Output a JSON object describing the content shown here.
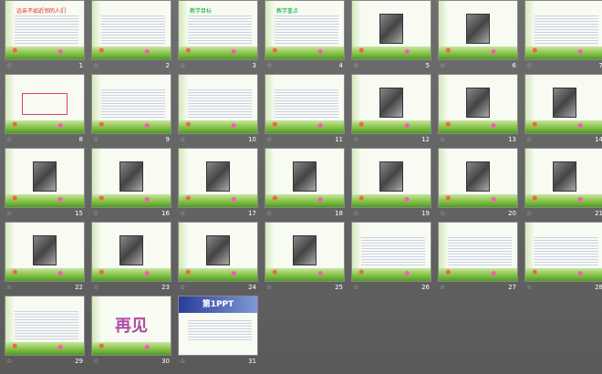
{
  "slides": [
    {
      "num": "1",
      "title": "远亲不如近邻的人们",
      "style": "text"
    },
    {
      "num": "2",
      "title": "",
      "style": "text"
    },
    {
      "num": "3",
      "title": "教学目标",
      "style": "text"
    },
    {
      "num": "4",
      "title": "教学重点",
      "style": "text"
    },
    {
      "num": "5",
      "title": "",
      "style": "pic"
    },
    {
      "num": "6",
      "title": "",
      "style": "pic"
    },
    {
      "num": "7",
      "title": "",
      "style": "text"
    },
    {
      "num": "8",
      "title": "",
      "style": "redbox"
    },
    {
      "num": "9",
      "title": "",
      "style": "text"
    },
    {
      "num": "10",
      "title": "",
      "style": "text"
    },
    {
      "num": "11",
      "title": "",
      "style": "text"
    },
    {
      "num": "12",
      "title": "",
      "style": "pic"
    },
    {
      "num": "13",
      "title": "",
      "style": "pic"
    },
    {
      "num": "14",
      "title": "",
      "style": "pic"
    },
    {
      "num": "15",
      "title": "",
      "style": "pic"
    },
    {
      "num": "16",
      "title": "",
      "style": "pic"
    },
    {
      "num": "17",
      "title": "",
      "style": "pic"
    },
    {
      "num": "18",
      "title": "",
      "style": "pic"
    },
    {
      "num": "19",
      "title": "",
      "style": "pic"
    },
    {
      "num": "20",
      "title": "",
      "style": "pic"
    },
    {
      "num": "21",
      "title": "",
      "style": "pic"
    },
    {
      "num": "22",
      "title": "",
      "style": "pic"
    },
    {
      "num": "23",
      "title": "",
      "style": "pic"
    },
    {
      "num": "24",
      "title": "",
      "style": "pic"
    },
    {
      "num": "25",
      "title": "",
      "style": "pic"
    },
    {
      "num": "26",
      "title": "",
      "style": "text"
    },
    {
      "num": "27",
      "title": "",
      "style": "text"
    },
    {
      "num": "28",
      "title": "",
      "style": "text"
    },
    {
      "num": "29",
      "title": "",
      "style": "text"
    },
    {
      "num": "30",
      "title": "再见",
      "style": "big"
    },
    {
      "num": "31",
      "title": "第1PPT",
      "style": "head"
    }
  ]
}
